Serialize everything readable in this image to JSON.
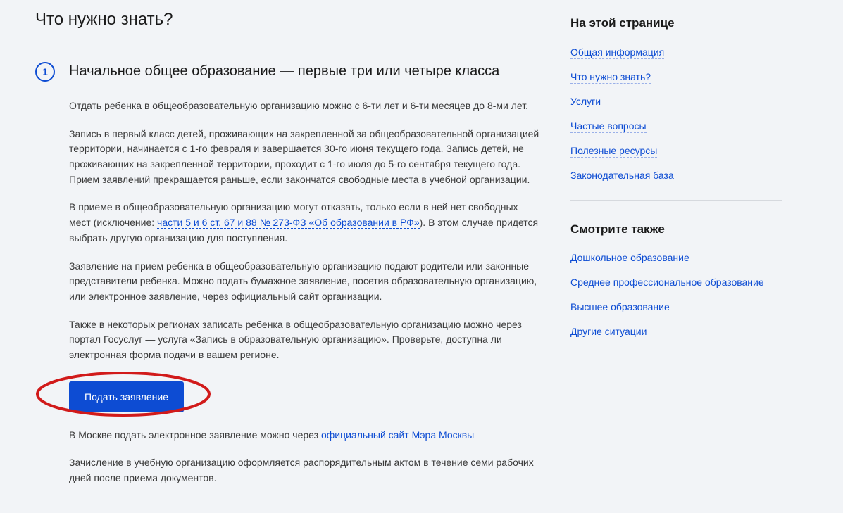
{
  "main": {
    "title": "Что нужно знать?",
    "section": {
      "number": "1",
      "heading": "Начальное общее образование — первые три или четыре класса",
      "para1": "Отдать ребенка в общеобразовательную организацию можно с 6-ти лет и 6-ти месяцев до 8-ми лет.",
      "para2": "Запись в первый класс детей, проживающих на закрепленной за общеобразовательной организацией территории, начинается с 1-го февраля и завершается 30-го июня текущего года. Запись детей, не проживающих на закрепленной территории, проходит с 1-го июля до 5-го сентября текущего года. Прием заявлений прекращается раньше, если закончатся свободные места в учебной организации.",
      "para3_a": "В приеме в общеобразовательную организацию могут отказать, только если в ней нет свободных мест (исключение: ",
      "para3_link": "части 5 и 6 ст. 67 и 88 № 273-ФЗ «Об образовании в РФ»",
      "para3_b": "). В этом случае придется выбрать другую организацию для поступления.",
      "para4": "Заявление на прием ребенка в общеобразовательную организацию подают родители или законные представители ребенка. Можно подать бумажное заявление, посетив образовательную организацию, или электронное заявление, через официальный сайт организации.",
      "para5": "Также в некоторых регионах записать ребенка в общеобразовательную организацию можно через портал Госуслуг — услуга «Запись в образовательную организацию». Проверьте, доступна ли электронная форма подачи в вашем регионе.",
      "button": "Подать заявление",
      "para6_a": "В Москве подать электронное заявление можно через ",
      "para6_link": "официальный сайт Мэра Москвы",
      "para7": "Зачисление в учебную организацию оформляется распорядительным актом в течение семи рабочих дней после приема документов."
    }
  },
  "sidebar": {
    "toc_title": "На этой странице",
    "toc": [
      "Общая информация",
      "Что нужно знать?",
      "Услуги",
      "Частые вопросы",
      "Полезные ресурсы",
      "Законодательная база"
    ],
    "related_title": "Смотрите также",
    "related": [
      "Дошкольное образование",
      "Среднее профессиональное образование",
      "Высшее образование",
      "Другие ситуации"
    ]
  }
}
